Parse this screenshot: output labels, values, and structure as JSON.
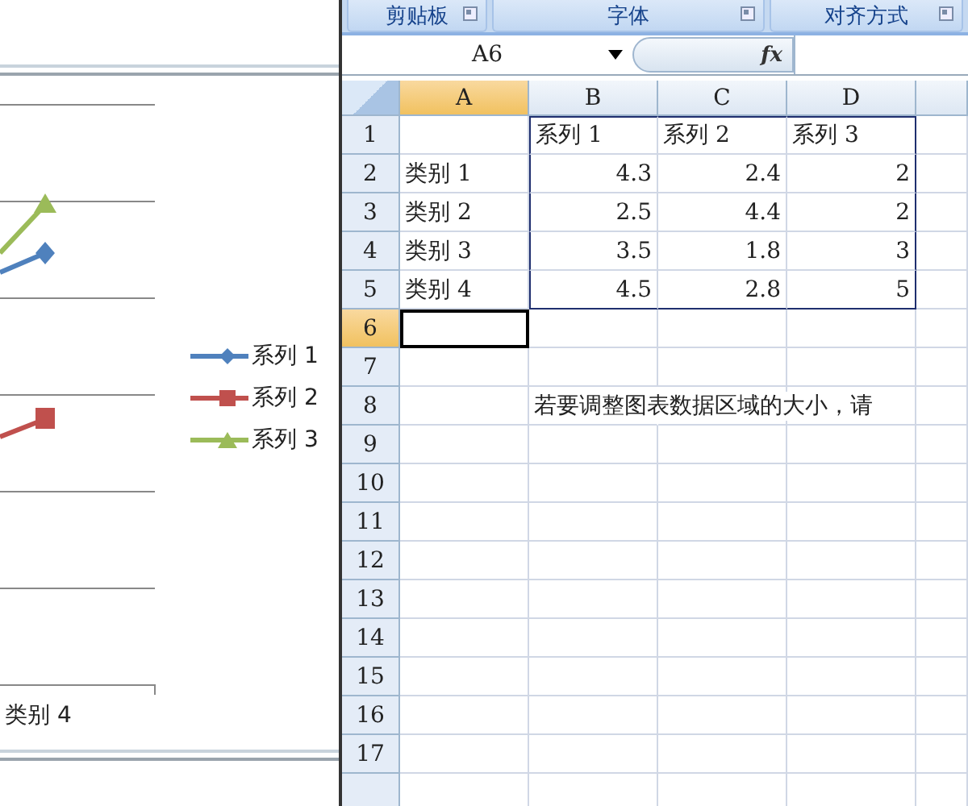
{
  "chart": {
    "legend": [
      {
        "label": "系列 1",
        "color": "#4f81bd",
        "kind": "diamond"
      },
      {
        "label": "系列 2",
        "color": "#c0504d",
        "kind": "square"
      },
      {
        "label": "系列 3",
        "color": "#9bbb59",
        "kind": "triangle"
      }
    ],
    "category_label": "类别 4"
  },
  "ribbon_groups": [
    {
      "label": "剪贴板"
    },
    {
      "label": "字体"
    },
    {
      "label": "对齐方式"
    }
  ],
  "formula_bar": {
    "name_box": "A6",
    "formula_label": "fx"
  },
  "columns": [
    {
      "label": "A",
      "selected": true,
      "in_range": false
    },
    {
      "label": "B",
      "selected": false,
      "in_range": true
    },
    {
      "label": "C",
      "selected": false,
      "in_range": true
    },
    {
      "label": "D",
      "selected": false,
      "in_range": true
    }
  ],
  "rows": [
    {
      "label": "1",
      "selected": false,
      "in_range": true,
      "cells": {
        "B": {
          "text": "系列 1",
          "kind": "text"
        },
        "C": {
          "text": "系列 2",
          "kind": "text"
        },
        "D": {
          "text": "系列 3",
          "kind": "text"
        }
      }
    },
    {
      "label": "2",
      "selected": false,
      "in_range": true,
      "cells": {
        "A": {
          "text": "类别 1",
          "kind": "text"
        },
        "B": {
          "text": "4.3",
          "kind": "number"
        },
        "C": {
          "text": "2.4",
          "kind": "number"
        },
        "D": {
          "text": "2",
          "kind": "number"
        }
      }
    },
    {
      "label": "3",
      "selected": false,
      "in_range": true,
      "cells": {
        "A": {
          "text": "类别 2",
          "kind": "text"
        },
        "B": {
          "text": "2.5",
          "kind": "number"
        },
        "C": {
          "text": "4.4",
          "kind": "number"
        },
        "D": {
          "text": "2",
          "kind": "number"
        }
      }
    },
    {
      "label": "4",
      "selected": false,
      "in_range": true,
      "cells": {
        "A": {
          "text": "类别 3",
          "kind": "text"
        },
        "B": {
          "text": "3.5",
          "kind": "number"
        },
        "C": {
          "text": "1.8",
          "kind": "number"
        },
        "D": {
          "text": "3",
          "kind": "number"
        }
      }
    },
    {
      "label": "5",
      "selected": false,
      "in_range": true,
      "cells": {
        "A": {
          "text": "类别 4",
          "kind": "text"
        },
        "B": {
          "text": "4.5",
          "kind": "number"
        },
        "C": {
          "text": "2.8",
          "kind": "number"
        },
        "D": {
          "text": "5",
          "kind": "number"
        }
      }
    },
    {
      "label": "6",
      "selected": true,
      "in_range": false,
      "cells": {}
    },
    {
      "label": "7",
      "selected": false,
      "in_range": false,
      "cells": {}
    },
    {
      "label": "8",
      "selected": false,
      "in_range": false,
      "cells": {
        "B": {
          "text": "若要调整图表数据区域的大小，请",
          "kind": "overflow"
        }
      }
    },
    {
      "label": "9",
      "selected": false,
      "in_range": false,
      "cells": {}
    },
    {
      "label": "10",
      "selected": false,
      "in_range": false,
      "cells": {}
    },
    {
      "label": "11",
      "selected": false,
      "in_range": false,
      "cells": {}
    },
    {
      "label": "12",
      "selected": false,
      "in_range": false,
      "cells": {}
    },
    {
      "label": "13",
      "selected": false,
      "in_range": false,
      "cells": {}
    },
    {
      "label": "14",
      "selected": false,
      "in_range": false,
      "cells": {}
    },
    {
      "label": "15",
      "selected": false,
      "in_range": false,
      "cells": {}
    },
    {
      "label": "16",
      "selected": false,
      "in_range": false,
      "cells": {}
    },
    {
      "label": "17",
      "selected": false,
      "in_range": false,
      "cells": {}
    }
  ]
}
